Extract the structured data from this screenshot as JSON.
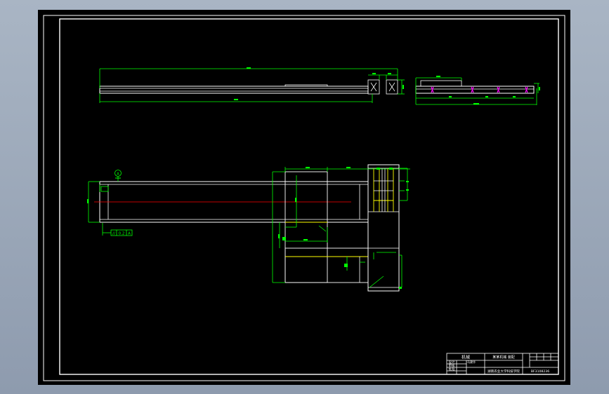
{
  "title_block": {
    "header_left": "机械",
    "row_label_1": "设计",
    "row_label_2": "审核",
    "row_label_3": "批准",
    "drawer": "马建华",
    "drawing_title": "某某机械 装配",
    "school": "湖南农业大学科技学院",
    "drawing_number": "BF3108236"
  },
  "annotations": {
    "parallelism_symbol": "//",
    "parallelism_value": "0.2",
    "parallelism_datum": "A",
    "datum_label": "A"
  },
  "colors": {
    "background": "#000000",
    "frame": "#ffffff",
    "dimension": "#00ff00",
    "centerline": "#ff0000",
    "hidden": "#ffff00",
    "section": "#ff00ff"
  }
}
